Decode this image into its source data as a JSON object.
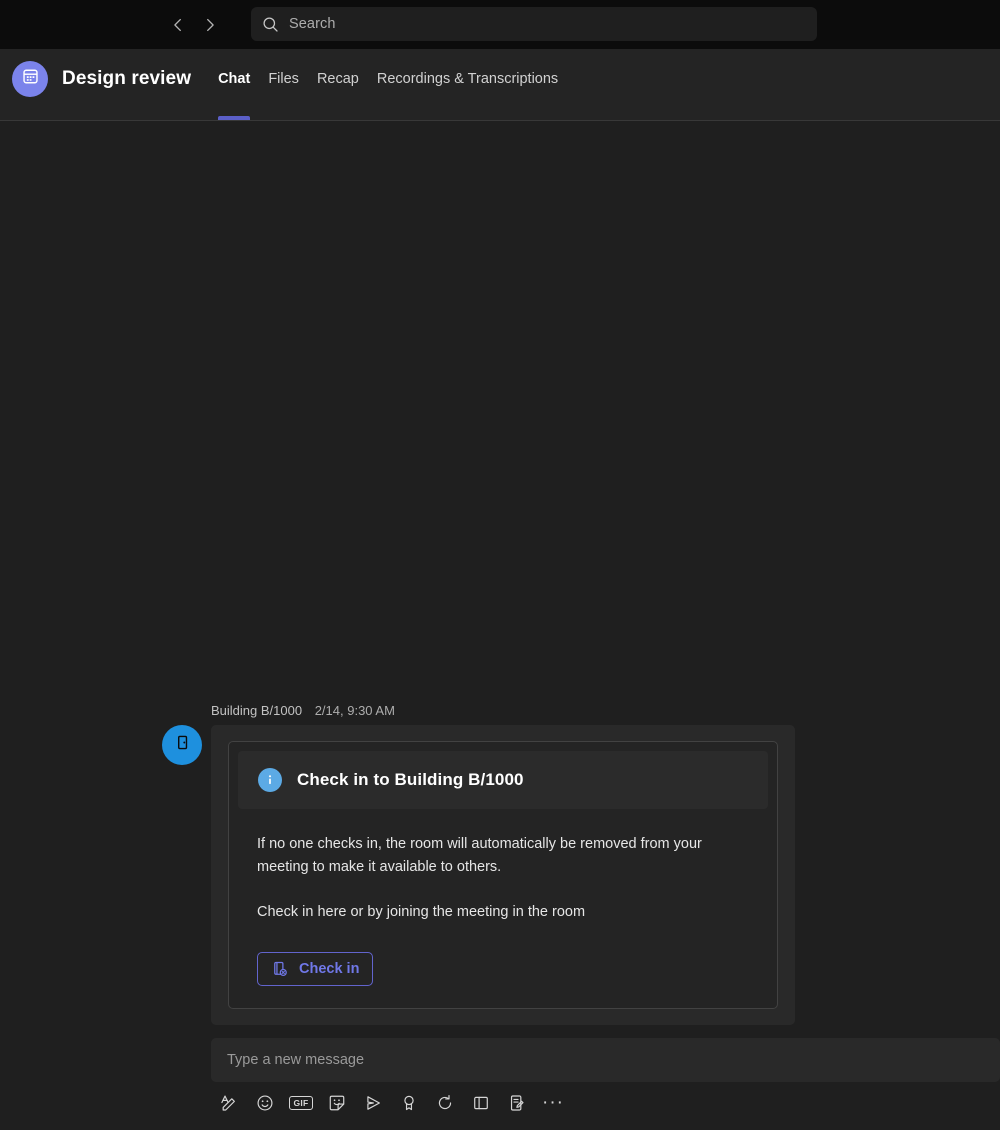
{
  "topbar": {
    "back_label": "Back",
    "forward_label": "Forward",
    "back_icon": "chevron-left-icon",
    "forward_icon": "chevron-right-icon",
    "search": {
      "icon": "search-icon",
      "placeholder": "Search",
      "value": ""
    }
  },
  "header": {
    "avatar_icon": "calendar-icon",
    "title": "Design review",
    "tabs": [
      {
        "label": "Chat",
        "active": true
      },
      {
        "label": "Files",
        "active": false
      },
      {
        "label": "Recap",
        "active": false
      },
      {
        "label": "Recordings & Transcriptions",
        "active": false
      }
    ]
  },
  "message": {
    "sender": "Building B/1000",
    "timestamp": "2/14, 9:30 AM",
    "avatar_icon": "room-door-icon",
    "card": {
      "banner_icon": "info-icon",
      "title": "Check in to Building B/1000",
      "paragraphs": [
        "If no one checks in, the room will automatically be removed from your meeting to make it available to others.",
        "Check in here or by joining the meeting in the room"
      ],
      "button": {
        "label": "Check in",
        "icon": "room-checkin-icon"
      }
    }
  },
  "compose": {
    "placeholder": "Type a new message",
    "value": "",
    "tools": [
      {
        "name": "format-icon",
        "title": "Format"
      },
      {
        "name": "emoji-icon",
        "title": "Emoji"
      },
      {
        "name": "gif-icon",
        "title": "GIF",
        "text": "GIF"
      },
      {
        "name": "sticker-icon",
        "title": "Sticker"
      },
      {
        "name": "send-plane-icon",
        "title": "Send"
      },
      {
        "name": "praise-badge-icon",
        "title": "Praise"
      },
      {
        "name": "loop-icon",
        "title": "Loop components"
      },
      {
        "name": "apps-icon",
        "title": "Apps"
      },
      {
        "name": "forms-icon",
        "title": "Forms"
      },
      {
        "name": "more-options-icon",
        "title": "More options",
        "text": "···"
      }
    ]
  },
  "colors": {
    "accent": "#5B5FC7",
    "avatar_meeting": "#7B83EB",
    "avatar_room": "#1E90DE",
    "info": "#5CAAE5",
    "button_border": "#6264CD",
    "button_text": "#7078E8",
    "topbar_bg": "#0c0c0c",
    "header_bg": "#242424",
    "chat_bg": "#1f1f1f",
    "bubble_bg": "#292929"
  }
}
